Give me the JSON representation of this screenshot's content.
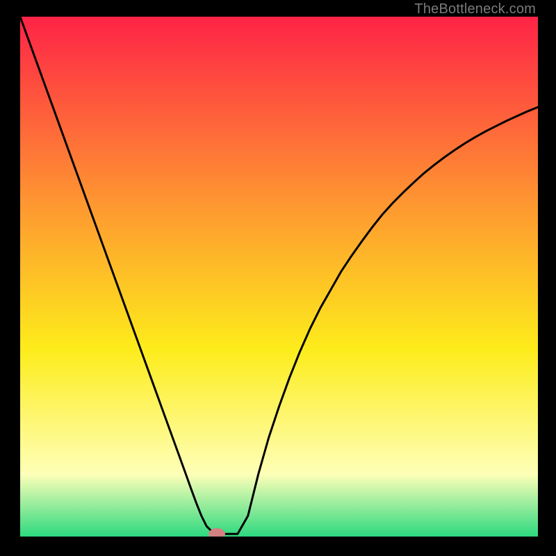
{
  "watermark": "TheBottleneck.com",
  "colors": {
    "bg_black": "#000000",
    "grad_top": "#fe2346",
    "grad_mid1": "#fe9731",
    "grad_mid2": "#fdec1b",
    "grad_mid3": "#feffb8",
    "grad_bottom": "#2dd97f",
    "curve": "#000000",
    "marker_fill": "#d38181",
    "marker_stroke": "#9a4a4a"
  },
  "chart_data": {
    "type": "line",
    "title": "",
    "xlabel": "",
    "ylabel": "",
    "xlim": [
      0,
      100
    ],
    "ylim": [
      0,
      100
    ],
    "x": [
      0,
      2,
      4,
      6,
      8,
      10,
      12,
      14,
      16,
      18,
      20,
      22,
      24,
      26,
      28,
      30,
      32,
      33,
      34,
      35,
      36,
      37,
      38,
      40,
      42,
      44,
      46,
      48,
      50,
      52,
      54,
      56,
      58,
      60,
      62,
      64,
      66,
      68,
      70,
      72,
      74,
      76,
      78,
      80,
      82,
      84,
      86,
      88,
      90,
      92,
      94,
      96,
      98,
      100
    ],
    "values": [
      100,
      94.5,
      89.0,
      83.5,
      78.0,
      72.5,
      67.0,
      61.5,
      56.0,
      50.5,
      45.0,
      39.5,
      34.0,
      28.5,
      23.0,
      17.5,
      12.0,
      9.2,
      6.5,
      4.0,
      2.0,
      1.0,
      0.5,
      0.5,
      0.5,
      4.0,
      12.0,
      19.0,
      25.0,
      30.5,
      35.5,
      40.0,
      44.0,
      47.5,
      51.0,
      54.0,
      56.8,
      59.5,
      62.0,
      64.2,
      66.2,
      68.1,
      69.9,
      71.5,
      73.0,
      74.4,
      75.7,
      76.9,
      78.0,
      79.0,
      80.0,
      80.9,
      81.8,
      82.6
    ],
    "marker": {
      "x": 38,
      "y": 0.5,
      "rx": 1.6,
      "ry": 1.1
    },
    "annotations": []
  }
}
